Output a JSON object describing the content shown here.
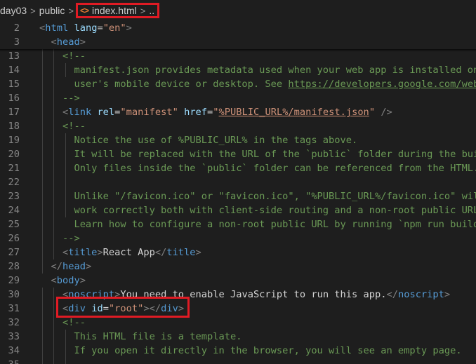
{
  "breadcrumb": {
    "items": [
      "day03",
      "public"
    ],
    "active_file": "index.html",
    "active_icon": "<>",
    "trailing": "..",
    "separator": ">"
  },
  "sticky_lines": [
    {
      "n": "2",
      "parts": [
        [
          "br",
          "<"
        ],
        [
          "tag",
          "html"
        ],
        [
          "txt",
          " "
        ],
        [
          "attr",
          "lang"
        ],
        [
          "txt",
          "="
        ],
        [
          "str",
          "\"en\""
        ],
        [
          "br",
          ">"
        ]
      ]
    },
    {
      "n": "3",
      "parts": [
        [
          "txt",
          "  "
        ],
        [
          "br",
          "<"
        ],
        [
          "tag",
          "head"
        ],
        [
          "br",
          ">"
        ]
      ]
    }
  ],
  "lines": [
    {
      "n": "13",
      "parts": [
        [
          "txt",
          "    "
        ],
        [
          "cm",
          "<!--"
        ]
      ]
    },
    {
      "n": "14",
      "parts": [
        [
          "txt",
          "      "
        ],
        [
          "cm",
          "manifest.json provides metadata used when your web app is installed on a"
        ]
      ]
    },
    {
      "n": "15",
      "parts": [
        [
          "txt",
          "      "
        ],
        [
          "cm",
          "user's mobile device or desktop. See "
        ],
        [
          "link",
          "https://developers.google.com/web/fundamentals/"
        ]
      ]
    },
    {
      "n": "16",
      "parts": [
        [
          "txt",
          "    "
        ],
        [
          "cm",
          "-->"
        ]
      ]
    },
    {
      "n": "17",
      "parts": [
        [
          "txt",
          "    "
        ],
        [
          "br",
          "<"
        ],
        [
          "tag",
          "link"
        ],
        [
          "txt",
          " "
        ],
        [
          "attr",
          "rel"
        ],
        [
          "txt",
          "="
        ],
        [
          "str",
          "\"manifest\""
        ],
        [
          "txt",
          " "
        ],
        [
          "attr",
          "href"
        ],
        [
          "txt",
          "="
        ],
        [
          "str",
          "\""
        ],
        [
          "strlink",
          "%PUBLIC_URL%/manifest.json"
        ],
        [
          "str",
          "\""
        ],
        [
          "txt",
          " "
        ],
        [
          "br",
          "/>"
        ]
      ]
    },
    {
      "n": "18",
      "parts": [
        [
          "txt",
          "    "
        ],
        [
          "cm",
          "<!--"
        ]
      ]
    },
    {
      "n": "19",
      "parts": [
        [
          "txt",
          "      "
        ],
        [
          "cm",
          "Notice the use of %PUBLIC_URL% in the tags above."
        ]
      ]
    },
    {
      "n": "20",
      "parts": [
        [
          "txt",
          "      "
        ],
        [
          "cm",
          "It will be replaced with the URL of the `public` folder during the build."
        ]
      ]
    },
    {
      "n": "21",
      "parts": [
        [
          "txt",
          "      "
        ],
        [
          "cm",
          "Only files inside the `public` folder can be referenced from the HTML."
        ]
      ]
    },
    {
      "n": "22",
      "parts": []
    },
    {
      "n": "23",
      "parts": [
        [
          "txt",
          "      "
        ],
        [
          "cm",
          "Unlike \"/favicon.ico\" or \"favicon.ico\", \"%PUBLIC_URL%/favicon.ico\" will"
        ]
      ]
    },
    {
      "n": "24",
      "parts": [
        [
          "txt",
          "      "
        ],
        [
          "cm",
          "work correctly both with client-side routing and a non-root public URL."
        ]
      ]
    },
    {
      "n": "25",
      "parts": [
        [
          "txt",
          "      "
        ],
        [
          "cm",
          "Learn how to configure a non-root public URL by running `npm run build`."
        ]
      ]
    },
    {
      "n": "26",
      "parts": [
        [
          "txt",
          "    "
        ],
        [
          "cm",
          "-->"
        ]
      ]
    },
    {
      "n": "27",
      "parts": [
        [
          "txt",
          "    "
        ],
        [
          "br",
          "<"
        ],
        [
          "tag",
          "title"
        ],
        [
          "br",
          ">"
        ],
        [
          "txt",
          "React App"
        ],
        [
          "br",
          "</"
        ],
        [
          "tag",
          "title"
        ],
        [
          "br",
          ">"
        ]
      ]
    },
    {
      "n": "28",
      "parts": [
        [
          "txt",
          "  "
        ],
        [
          "br",
          "</"
        ],
        [
          "tag",
          "head"
        ],
        [
          "br",
          ">"
        ]
      ]
    },
    {
      "n": "29",
      "parts": [
        [
          "txt",
          "  "
        ],
        [
          "br",
          "<"
        ],
        [
          "tag",
          "body"
        ],
        [
          "br",
          ">"
        ]
      ]
    },
    {
      "n": "30",
      "parts": [
        [
          "txt",
          "    "
        ],
        [
          "br",
          "<"
        ],
        [
          "tag",
          "noscript"
        ],
        [
          "br",
          ">"
        ],
        [
          "txt",
          "You need to enable JavaScript to run this app."
        ],
        [
          "br",
          "</"
        ],
        [
          "tag",
          "noscript"
        ],
        [
          "br",
          ">"
        ]
      ]
    },
    {
      "n": "31",
      "parts": [
        [
          "txt",
          "    "
        ],
        [
          "br",
          "<"
        ],
        [
          "tag",
          "div"
        ],
        [
          "txt",
          " "
        ],
        [
          "attr",
          "id"
        ],
        [
          "txt",
          "="
        ],
        [
          "str",
          "\"root\""
        ],
        [
          "br",
          "></"
        ],
        [
          "tag",
          "div"
        ],
        [
          "br",
          ">"
        ]
      ]
    },
    {
      "n": "32",
      "parts": [
        [
          "txt",
          "    "
        ],
        [
          "cm",
          "<!--"
        ]
      ]
    },
    {
      "n": "33",
      "parts": [
        [
          "txt",
          "      "
        ],
        [
          "cm",
          "This HTML file is a template."
        ]
      ]
    },
    {
      "n": "34",
      "parts": [
        [
          "txt",
          "      "
        ],
        [
          "cm",
          "If you open it directly in the browser, you will see an empty page."
        ]
      ]
    },
    {
      "n": "35",
      "parts": []
    }
  ]
}
